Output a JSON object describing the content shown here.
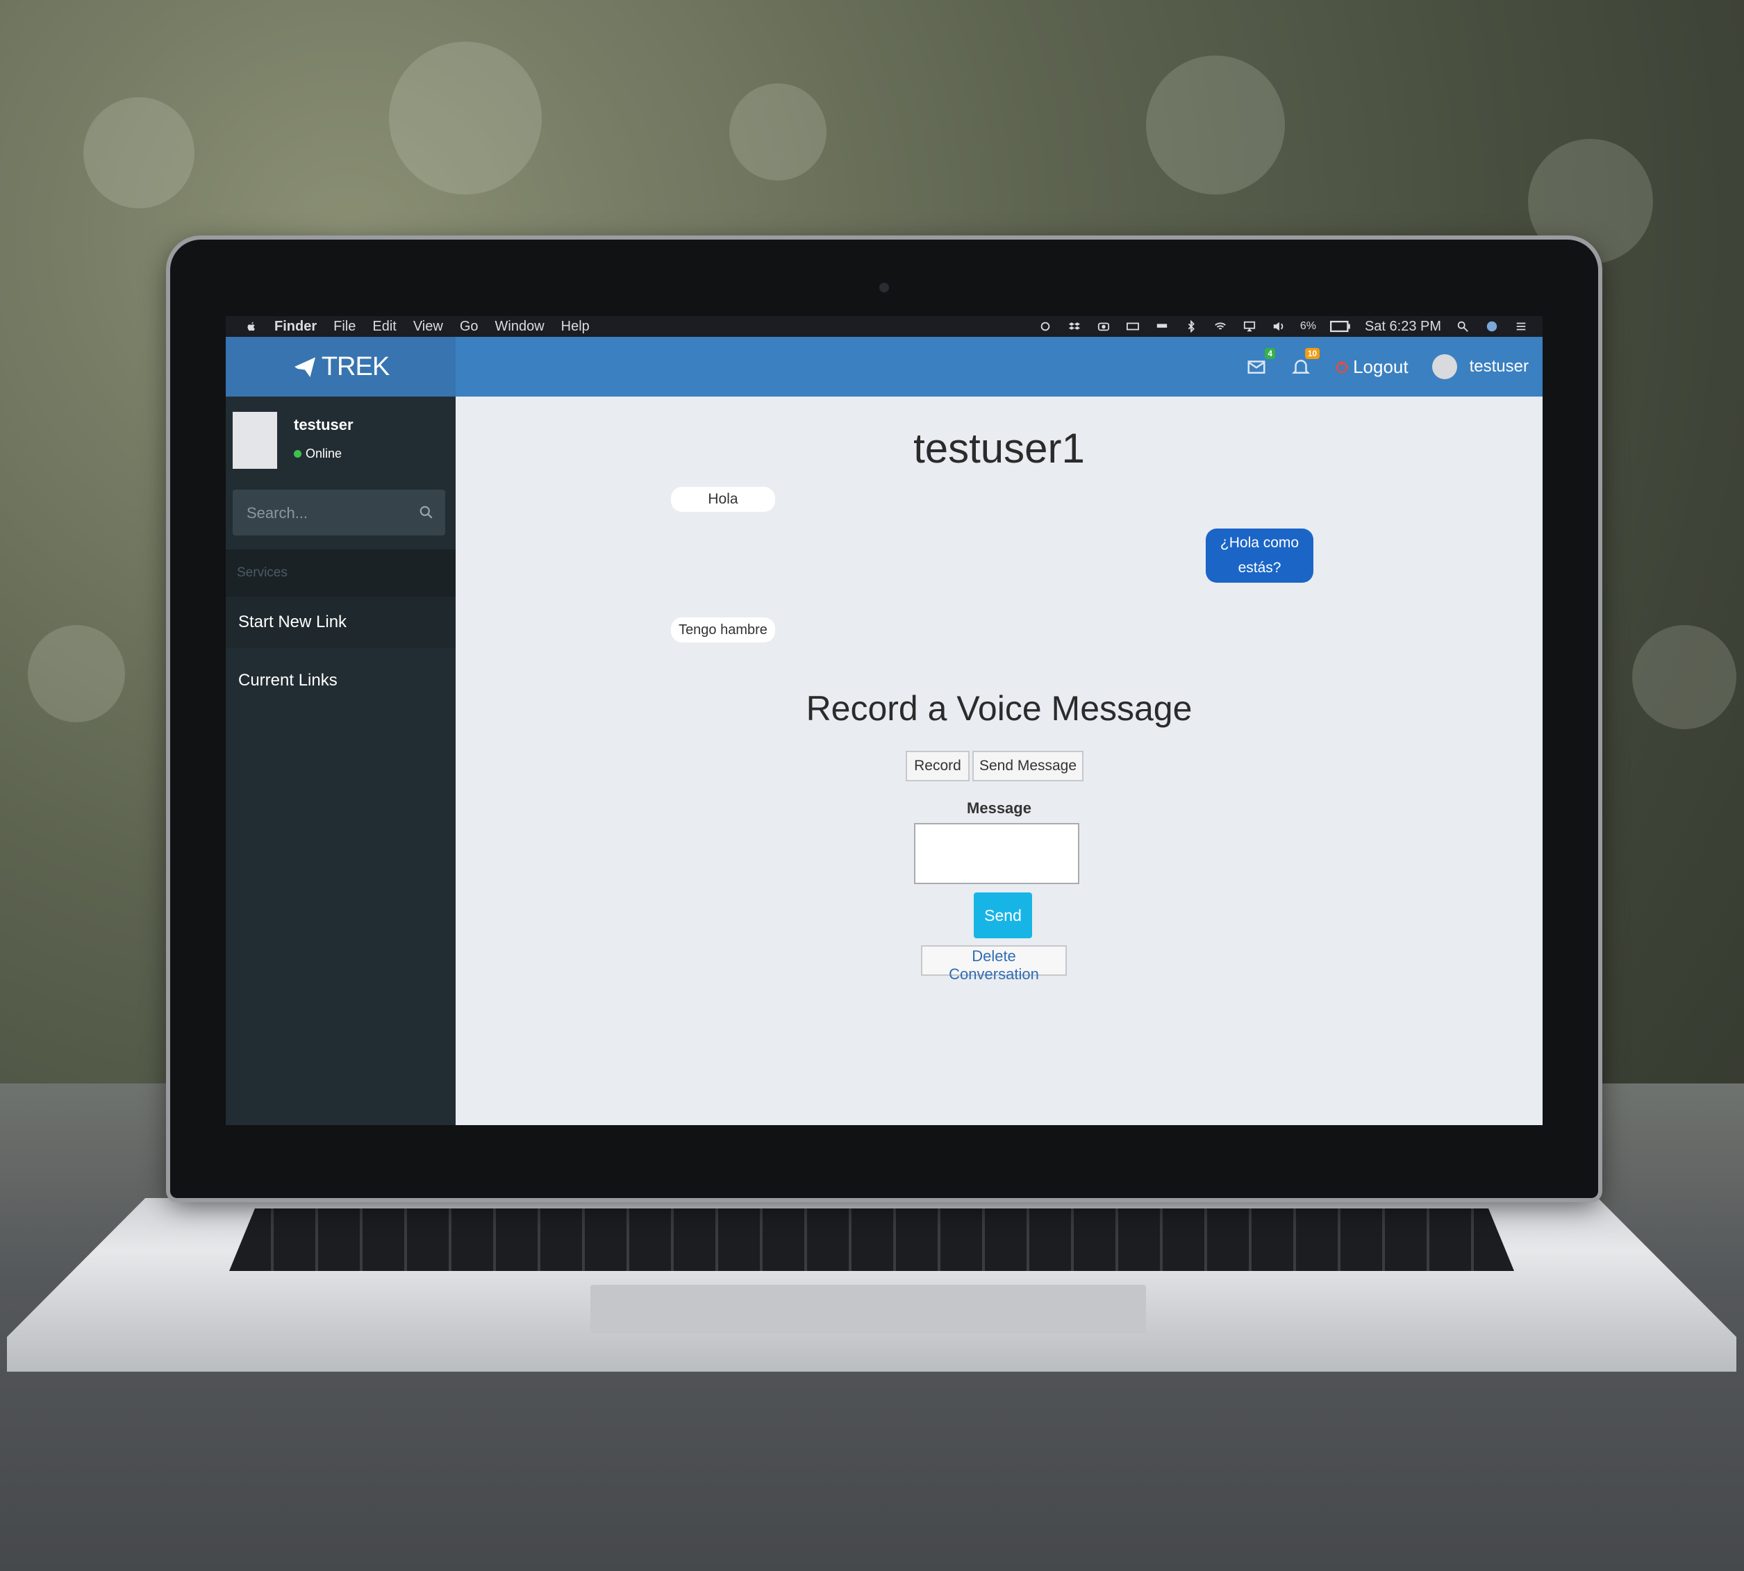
{
  "menubar": {
    "items": [
      "Finder",
      "File",
      "Edit",
      "View",
      "Go",
      "Window",
      "Help"
    ],
    "battery": "6%",
    "clock": "Sat 6:23 PM"
  },
  "navbar": {
    "brand": "TREK",
    "messages_badge": "4",
    "notifications_badge": "10",
    "logout_label": "Logout",
    "username": "testuser"
  },
  "sidebar": {
    "user_name": "testuser",
    "status": "Online",
    "search_placeholder": "Search...",
    "section_header": "Services",
    "items": [
      {
        "label": "Start New Link"
      },
      {
        "label": "Current Links"
      }
    ]
  },
  "main": {
    "conversation_title": "testuser1",
    "messages": [
      {
        "text": "Hola",
        "side": "incoming"
      },
      {
        "text": "¿Hola como estás?",
        "side": "outgoing"
      },
      {
        "text": "Tengo hambre",
        "side": "incoming"
      }
    ],
    "voice_title": "Record a Voice Message",
    "record_label": "Record",
    "send_message_label": "Send Message",
    "message_label": "Message",
    "send_label": "Send",
    "delete_label": "Delete Conversation"
  },
  "colors": {
    "navbar": "#3b80c0",
    "sidebar": "#222d33",
    "outgoing_bubble": "#1b65c7",
    "send_button": "#17b5e6"
  }
}
